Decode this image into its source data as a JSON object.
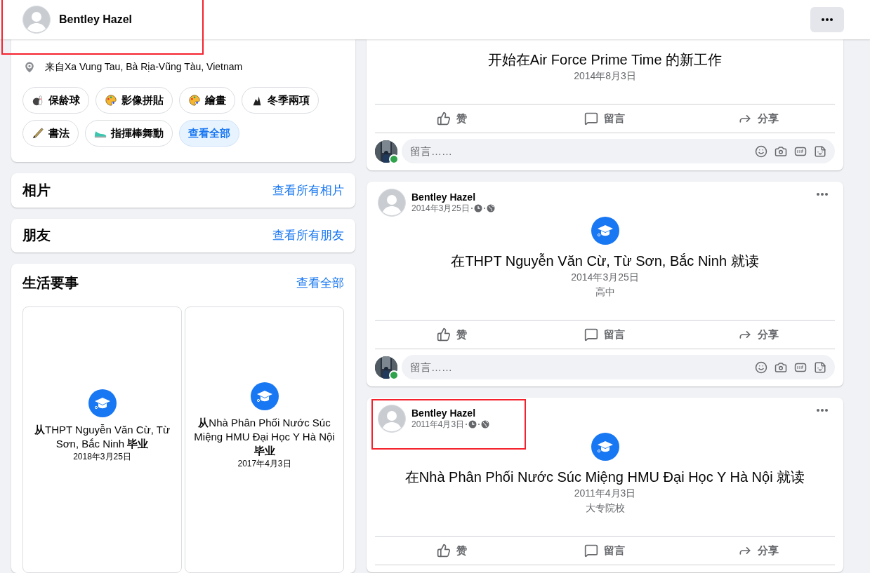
{
  "header": {
    "name": "Bentley Hazel",
    "highlighted": true
  },
  "intro": {
    "location": "来自Xa Vung Tau, Bà Rịa-Vũng Tàu, Vietnam",
    "hobbies": [
      {
        "label": "保龄球",
        "kind": "bowling"
      },
      {
        "label": "影像拼貼",
        "kind": "palette"
      },
      {
        "label": "繪畫",
        "kind": "palette"
      },
      {
        "label": "冬季兩項",
        "kind": "skiing"
      },
      {
        "label": "書法",
        "kind": "brush"
      },
      {
        "label": "指揮棒舞動",
        "kind": "shoe"
      }
    ],
    "see_all": "查看全部"
  },
  "sections": [
    {
      "title": "相片",
      "link": "查看所有相片"
    },
    {
      "title": "朋友",
      "link": "查看所有朋友"
    }
  ],
  "life_events": {
    "title": "生活要事",
    "link": "查看全部",
    "items": [
      {
        "text": "**从**THPT Nguyễn Văn Cừ, Từ Sơn, Bắc Ninh **毕业**",
        "date": "2018年3月25日"
      },
      {
        "text": "**从**Nhà Phân Phối Nước Súc Miệng HMU Đại Học Y Hà Nội **毕业**",
        "date": "2017年4月3日"
      }
    ]
  },
  "posts": [
    {
      "title": "开始在Air Force Prime Time 的新工作",
      "date": "2014年8月3日",
      "actions": [
        "赞",
        "留言",
        "分享"
      ],
      "comment_placeholder": "留言……"
    },
    {
      "author": "Bentley Hazel",
      "time": "2014年3月25日",
      "kind": "graduation",
      "title": "在THPT Nguyễn Văn Cừ, Từ Sơn, Bắc Ninh 就读",
      "date": "2014年3月25日",
      "detail": "高中",
      "actions": [
        "赞",
        "留言",
        "分享"
      ],
      "comment_placeholder": "留言……",
      "highlighted": false
    },
    {
      "author": "Bentley Hazel",
      "time": "2011年4月3日",
      "kind": "graduation",
      "title": "在Nhà Phân Phối Nước Súc Miệng HMU Đại Học Y Hà Nội 就读",
      "date": "2011年4月3日",
      "detail": "大专院校",
      "actions": [
        "赞",
        "留言",
        "分享"
      ],
      "highlighted": true
    }
  ]
}
